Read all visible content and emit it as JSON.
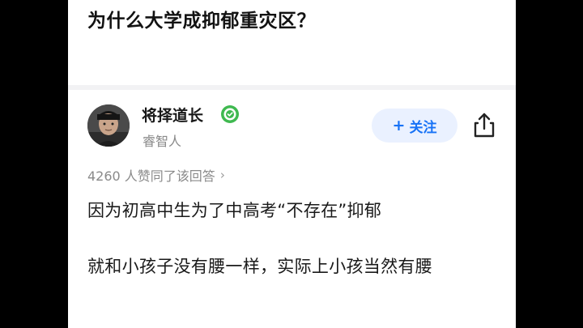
{
  "question": {
    "title": "为什么大学成抑郁重灾区？"
  },
  "author": {
    "name": "将择道长",
    "subtitle": "睿智人",
    "badge_icon": "certified-badge-icon",
    "avatar_icon": "user-avatar"
  },
  "actions": {
    "follow_plus": "+",
    "follow_label": "关注",
    "share_icon": "share-icon"
  },
  "answer": {
    "votes_text": "4260 人赞同了该回答",
    "votes_chevron": "›",
    "paragraphs": [
      "因为初高中生为了中高考“不存在”抑郁",
      "就和小孩子没有腰一样，实际上小孩当然有腰"
    ]
  },
  "colors": {
    "accent": "#1772f6",
    "follow_bg": "#eaf1ff",
    "badge_green": "#3fb950",
    "muted_text": "#8a8a8a"
  }
}
